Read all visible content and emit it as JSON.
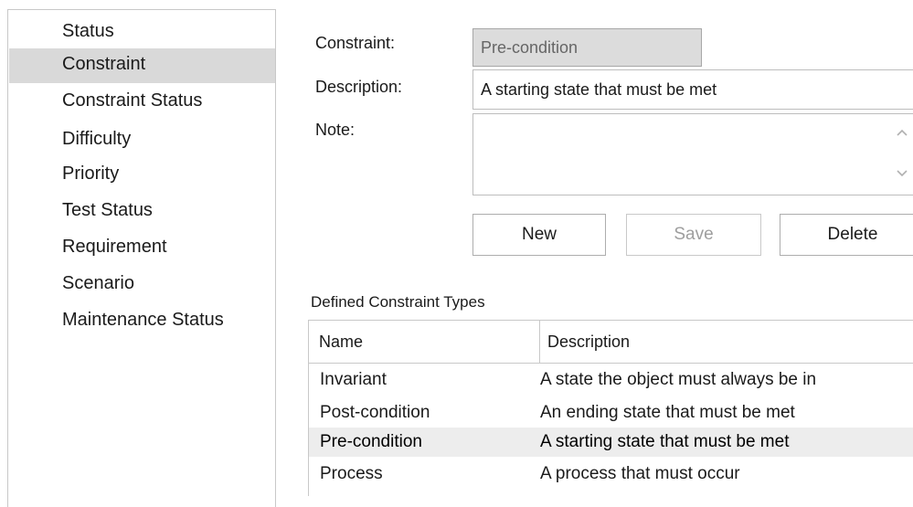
{
  "sidebar": {
    "items": [
      {
        "label": "Status",
        "selected": false
      },
      {
        "label": "Constraint",
        "selected": true
      },
      {
        "label": "Constraint Status",
        "selected": false
      },
      {
        "label": "Difficulty",
        "selected": false
      },
      {
        "label": "Priority",
        "selected": false
      },
      {
        "label": "Test Status",
        "selected": false
      },
      {
        "label": "Requirement",
        "selected": false
      },
      {
        "label": "Scenario",
        "selected": false
      },
      {
        "label": "Maintenance Status",
        "selected": false
      }
    ]
  },
  "form": {
    "constraint_label": "Constraint:",
    "constraint_value": "Pre-condition",
    "description_label": "Description:",
    "description_value": "A starting state that must be met",
    "note_label": "Note:",
    "note_value": ""
  },
  "buttons": {
    "new": "New",
    "save": "Save",
    "delete": "Delete"
  },
  "table": {
    "caption": "Defined Constraint Types",
    "columns": [
      "Name",
      "Description"
    ],
    "rows": [
      {
        "name": "Invariant",
        "description": "A state the object must always be in",
        "selected": false
      },
      {
        "name": "Post-condition",
        "description": "An ending state that must be met",
        "selected": false
      },
      {
        "name": "Pre-condition",
        "description": "A starting state that must be met",
        "selected": true
      },
      {
        "name": "Process",
        "description": "A process that must occur",
        "selected": false
      }
    ]
  },
  "colors": {
    "selection": "#d9d9d9",
    "row_selection": "#ededed",
    "border": "#c8c8c8"
  }
}
